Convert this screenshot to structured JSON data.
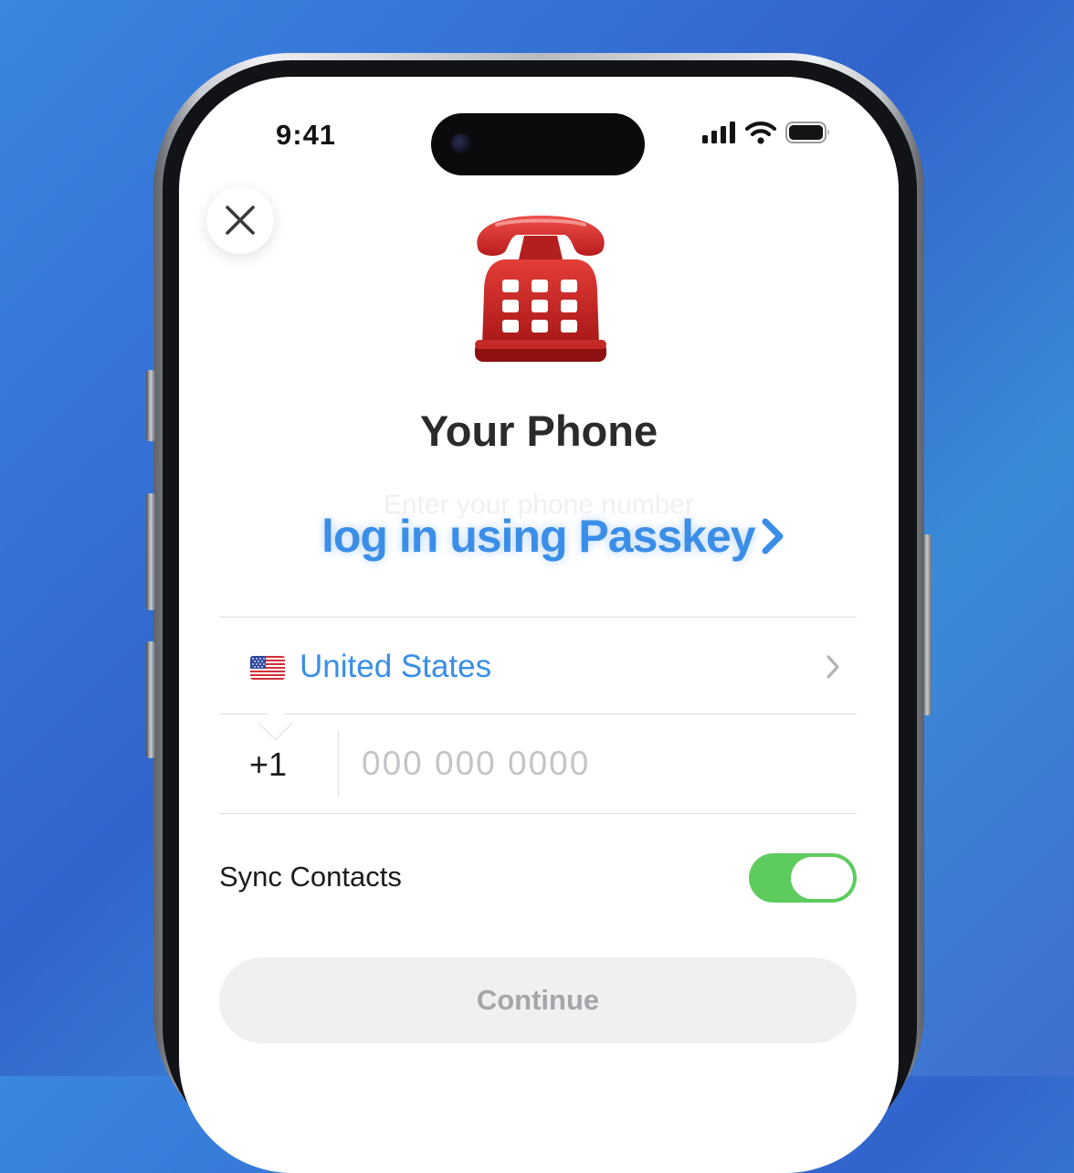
{
  "status_bar": {
    "time": "9:41",
    "icons": [
      "cellular-signal-icon",
      "wifi-icon",
      "battery-icon"
    ]
  },
  "header": {
    "close_icon": "close-icon",
    "hero_icon": "telephone-icon",
    "title": "Your Phone",
    "subtitle": "Enter your phone number",
    "passkey_label": "log in using Passkey",
    "passkey_icon": "chevron-right-icon"
  },
  "form": {
    "country": {
      "flag_icon": "us-flag-icon",
      "name": "United States"
    },
    "phone": {
      "country_code": "+1",
      "value": "",
      "placeholder": "000 000 0000"
    },
    "sync_contacts": {
      "label": "Sync Contacts",
      "enabled": true
    },
    "continue_label": "Continue"
  },
  "colors": {
    "accent": "#3a8ee6",
    "toggle_on": "#5ecb5e",
    "button_disabled_bg": "#f0f0f2",
    "button_disabled_text": "#a5a5aa"
  }
}
